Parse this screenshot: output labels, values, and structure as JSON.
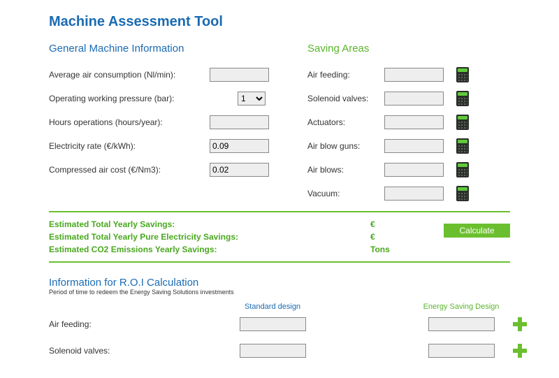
{
  "title": "Machine Assessment Tool",
  "general": {
    "heading": "General Machine Information",
    "rows": {
      "air_consumption": {
        "label": "Average air consumption (Nl/min):",
        "value": ""
      },
      "working_pressure": {
        "label": "Operating working pressure (bar):",
        "value": "1"
      },
      "hours": {
        "label": "Hours operations (hours/year):",
        "value": ""
      },
      "elec_rate": {
        "label": "Electricity rate (€/kWh):",
        "value": "0.09"
      },
      "air_cost": {
        "label": "Compressed air cost (€/Nm3):",
        "value": "0.02"
      }
    }
  },
  "saving": {
    "heading": "Saving Areas",
    "rows": {
      "air_feeding": {
        "label": "Air feeding:",
        "value": ""
      },
      "solenoid": {
        "label": "Solenoid valves:",
        "value": ""
      },
      "actuators": {
        "label": "Actuators:",
        "value": ""
      },
      "blow_guns": {
        "label": "Air blow guns:",
        "value": ""
      },
      "air_blows": {
        "label": "Air blows:",
        "value": ""
      },
      "vacuum": {
        "label": "Vacuum:",
        "value": ""
      }
    }
  },
  "summary": {
    "l1": "Estimated Total Yearly Savings:",
    "l2": "Estimated Total Yearly Pure Electricity Savings:",
    "l3": "Estimated CO2 Emissions Yearly Savings:",
    "v1": "€",
    "v2": "€",
    "v3": "Tons",
    "calc_btn": "Calculate"
  },
  "roi": {
    "heading": "Information for R.O.I Calculation",
    "sub": "Period of time to redeem the Energy Saving Solutions investments",
    "col1": "Standard design",
    "col2": "Energy Saving Design",
    "rows": {
      "air_feeding": {
        "label": "Air feeding:",
        "std": "",
        "es": ""
      },
      "solenoid": {
        "label": "Solenoid valves:",
        "std": "",
        "es": ""
      }
    }
  }
}
